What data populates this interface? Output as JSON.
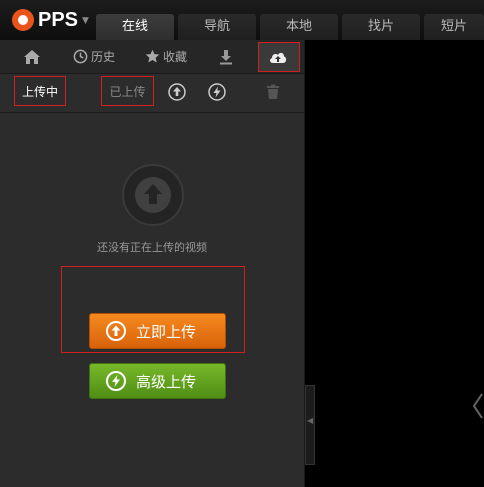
{
  "logo": {
    "text": "PPS",
    "caret": "▼"
  },
  "tabs": [
    "在线",
    "导航",
    "本地",
    "找片",
    "短片"
  ],
  "subnav": {
    "history": "历史",
    "favorites": "收藏"
  },
  "toolbar": {
    "uploading": "上传中",
    "uploaded": "已上传"
  },
  "empty_state": {
    "message": "还没有正在上传的视频"
  },
  "buttons": {
    "upload_now": "立即上传",
    "advanced_upload": "高级上传"
  },
  "colors": {
    "accent_red": "#d02020",
    "orange": "#f08020",
    "green": "#68a828"
  }
}
